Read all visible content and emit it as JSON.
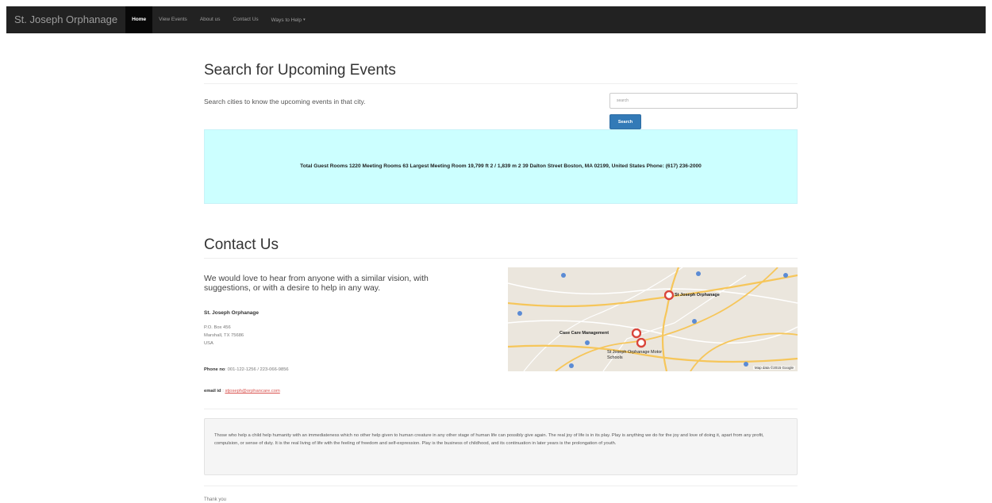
{
  "navbar": {
    "brand": "St. Joseph Orphanage",
    "items": [
      {
        "label": "Home",
        "active": true
      },
      {
        "label": "View Events"
      },
      {
        "label": "About us"
      },
      {
        "label": "Contact Us"
      },
      {
        "label": "Ways to Help"
      }
    ]
  },
  "search": {
    "title": "Search for Upcoming Events",
    "description": "Search cities to know the upcoming events in that city.",
    "placeholder": "search",
    "button_label": "Search",
    "info_text": "Total Guest Rooms 1220 Meeting Rooms 63 Largest Meeting Room 19,799 ft 2 / 1,839 m 2 39 Dalton Street Boston, MA 02199, United States Phone: (617) 236-2000"
  },
  "contact": {
    "title": "Contact Us",
    "lead": "We would love to hear from anyone with a similar vision, with suggestions, or with a desire to help in any way.",
    "org_name": "St. Joseph Orphanage",
    "address_lines": [
      "P.O. Box 456",
      "Marshall, TX 75686",
      "USA"
    ],
    "phone_label": "Phone no",
    "phone_value": ": 001-122-1256 / 223-066-9856",
    "email_label": "email id",
    "email_value": "stjoseph@orphancare.com"
  },
  "map": {
    "labels": [
      "St Joseph Orphanage",
      "Case Care Management",
      "St Joseph Orphanage Motor Schools"
    ],
    "credit": "Map data ©2015 Google"
  },
  "quote": "Those who help a child help humanity with an immediateness which no other help given to human creature in any other stage of human life can possibly give again. The real joy of life is in its play. Play is anything we do for the joy and love of doing it, apart from any profit, compulsion, or sense of duty. It is the real living of life with the feeling of freedom and self-expression. Play is the business of childhood, and its continuation in later years is the prolongation of youth.",
  "footer": {
    "thanks": "Thank you"
  },
  "colors": {
    "navbar": "#222222",
    "primary": "#337ab7",
    "info_bg": "#ccffff",
    "link": "#d9534f",
    "map_marker": "#d9453b"
  }
}
